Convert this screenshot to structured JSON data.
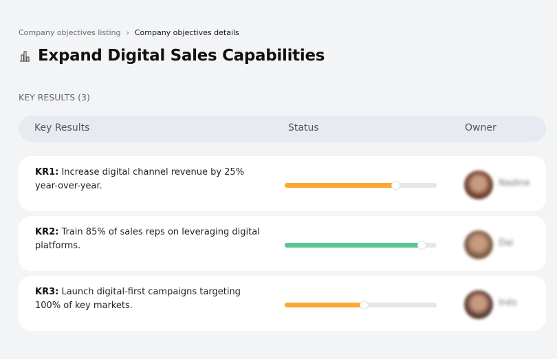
{
  "breadcrumb": {
    "parent": "Company objectives listing",
    "separator": "›",
    "current": "Company objectives details"
  },
  "page": {
    "icon": "building-chart-icon",
    "title": "Expand Digital Sales Capabilities"
  },
  "section_label": "KEY RESULTS (3)",
  "table": {
    "headers": {
      "key_results": "Key Results",
      "status": "Status",
      "owner": "Owner"
    },
    "rows": [
      {
        "code": "KR1:",
        "text": "Increase digital channel revenue by 25% year-over-year.",
        "progress": 73,
        "color": "#ffa630",
        "owner": "Nadine",
        "avatar_color": "#6b3b2a"
      },
      {
        "code": "KR2:",
        "text": "Train 85% of sales reps on leveraging digital platforms.",
        "progress": 90,
        "color": "#58c68f",
        "owner": "Dai",
        "avatar_color": "#7a5a40"
      },
      {
        "code": "KR3:",
        "text": "Launch digital-first campaigns targeting 100% of key markets.",
        "progress": 52,
        "color": "#ffa630",
        "owner": "Inés",
        "avatar_color": "#5a3a30"
      }
    ]
  }
}
